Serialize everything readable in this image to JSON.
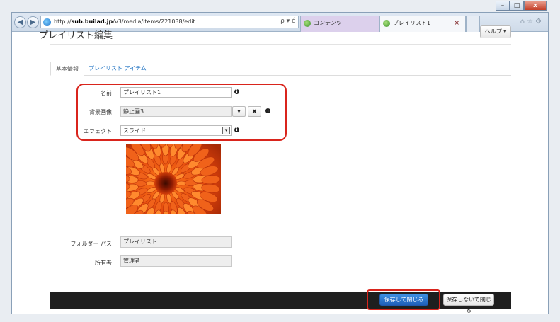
{
  "browser": {
    "url_prefix": "http://",
    "url_host": "sub.builad.jp",
    "url_path": "/v3/media/items/221038/edit",
    "address_tools": "ρ ▾ ć",
    "tabs": [
      {
        "label": "コンテンツ"
      },
      {
        "label": "プレイリスト1",
        "close": "×"
      }
    ],
    "window_controls": {
      "minimize": "–",
      "maximize": "□",
      "close": "x"
    },
    "right_icons": "⌂☆⚙"
  },
  "page": {
    "title": "プレイリスト編集",
    "help_label": "ヘルプ ▾"
  },
  "tabs": {
    "basic": "基本情報",
    "items": "プレイリスト アイテム"
  },
  "form": {
    "name_label": "名前",
    "name_value": "プレイリスト1",
    "bg_label": "背景画像",
    "bg_value": "静止画3",
    "effect_label": "エフェクト",
    "effect_value": "スライド",
    "folder_label": "フォルダー パス",
    "folder_value": "プレイリスト",
    "owner_label": "所有者",
    "owner_value": "管理者",
    "info_glyph": "i",
    "caret_glyph": "▾",
    "clear_glyph": "✖",
    "select_arrow": "▾"
  },
  "footer": {
    "save_label": "保存して閉じる",
    "nosave_label": "保存しないで閉じる"
  },
  "colors": {
    "highlight": "#d9241c",
    "primary_button": "#1f5fb8",
    "link": "#2a7ac6"
  }
}
